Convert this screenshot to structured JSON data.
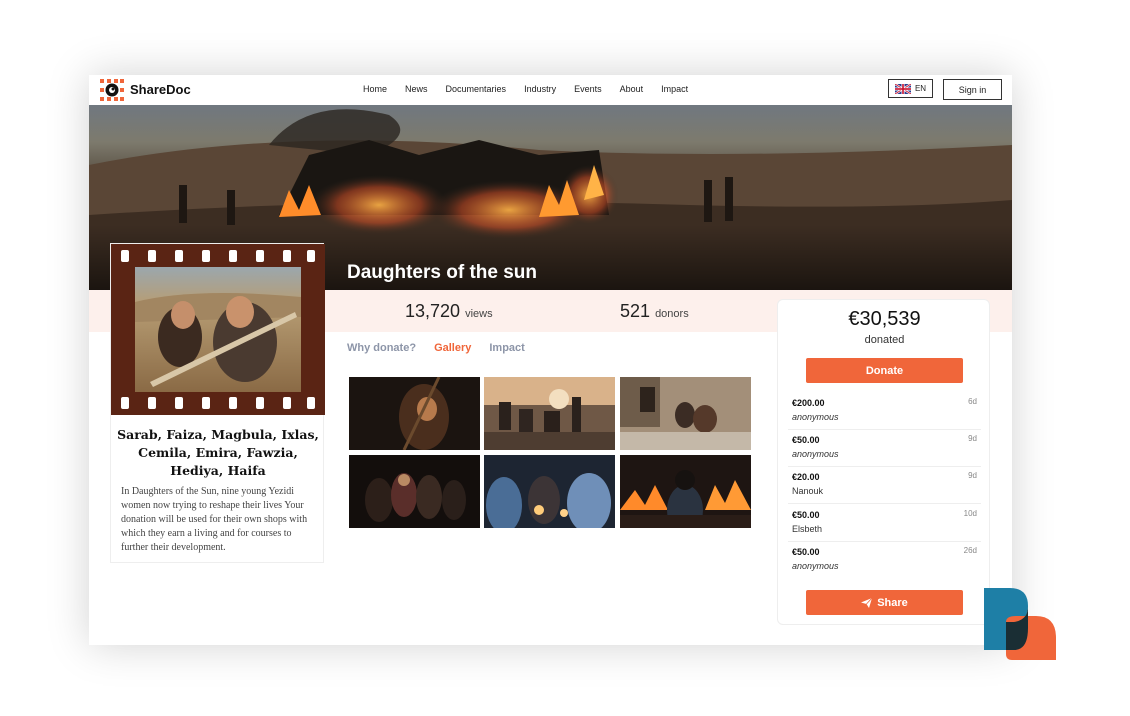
{
  "header": {
    "brand": "ShareDoc",
    "nav": [
      "Home",
      "News",
      "Documentaries",
      "Industry",
      "Events",
      "About",
      "Impact"
    ],
    "language": "EN",
    "signin_label": "Sign in"
  },
  "hero": {
    "title": "Daughters of the sun"
  },
  "stats": {
    "views_count": "13,720",
    "views_label": "views",
    "donors_count": "521",
    "donors_label": "donors"
  },
  "card": {
    "names": "Sarab, Faiza, Magbula, Ixlas, Cemila, Emira, Fawzia, Hediya, Haifa",
    "description": "In Daughters of the Sun, nine young Yezidi women now trying to reshape their lives Your donation will be used for their own shops with which they earn a living and for courses to further their development."
  },
  "tabs": [
    {
      "label": "Why donate?",
      "active": false
    },
    {
      "label": "Gallery",
      "active": true
    },
    {
      "label": "Impact",
      "active": false
    }
  ],
  "donation": {
    "amount": "€30,539",
    "donated_label": "donated",
    "donate_button": "Donate",
    "share_button": "Share",
    "donors": [
      {
        "amount": "€200.00",
        "name": "anonymous",
        "time": "6d"
      },
      {
        "amount": "€50.00",
        "name": "anonymous",
        "time": "9d"
      },
      {
        "amount": "€20.00",
        "name": "Nanouk",
        "time": "9d"
      },
      {
        "amount": "€50.00",
        "name": "Elsbeth",
        "time": "10d"
      },
      {
        "amount": "€50.00",
        "name": "anonymous",
        "time": "26d"
      }
    ]
  },
  "colors": {
    "accent": "#f0663a",
    "film": "#5a2414",
    "band": "#fdf0ec",
    "tab_inactive": "#8d95a8"
  }
}
